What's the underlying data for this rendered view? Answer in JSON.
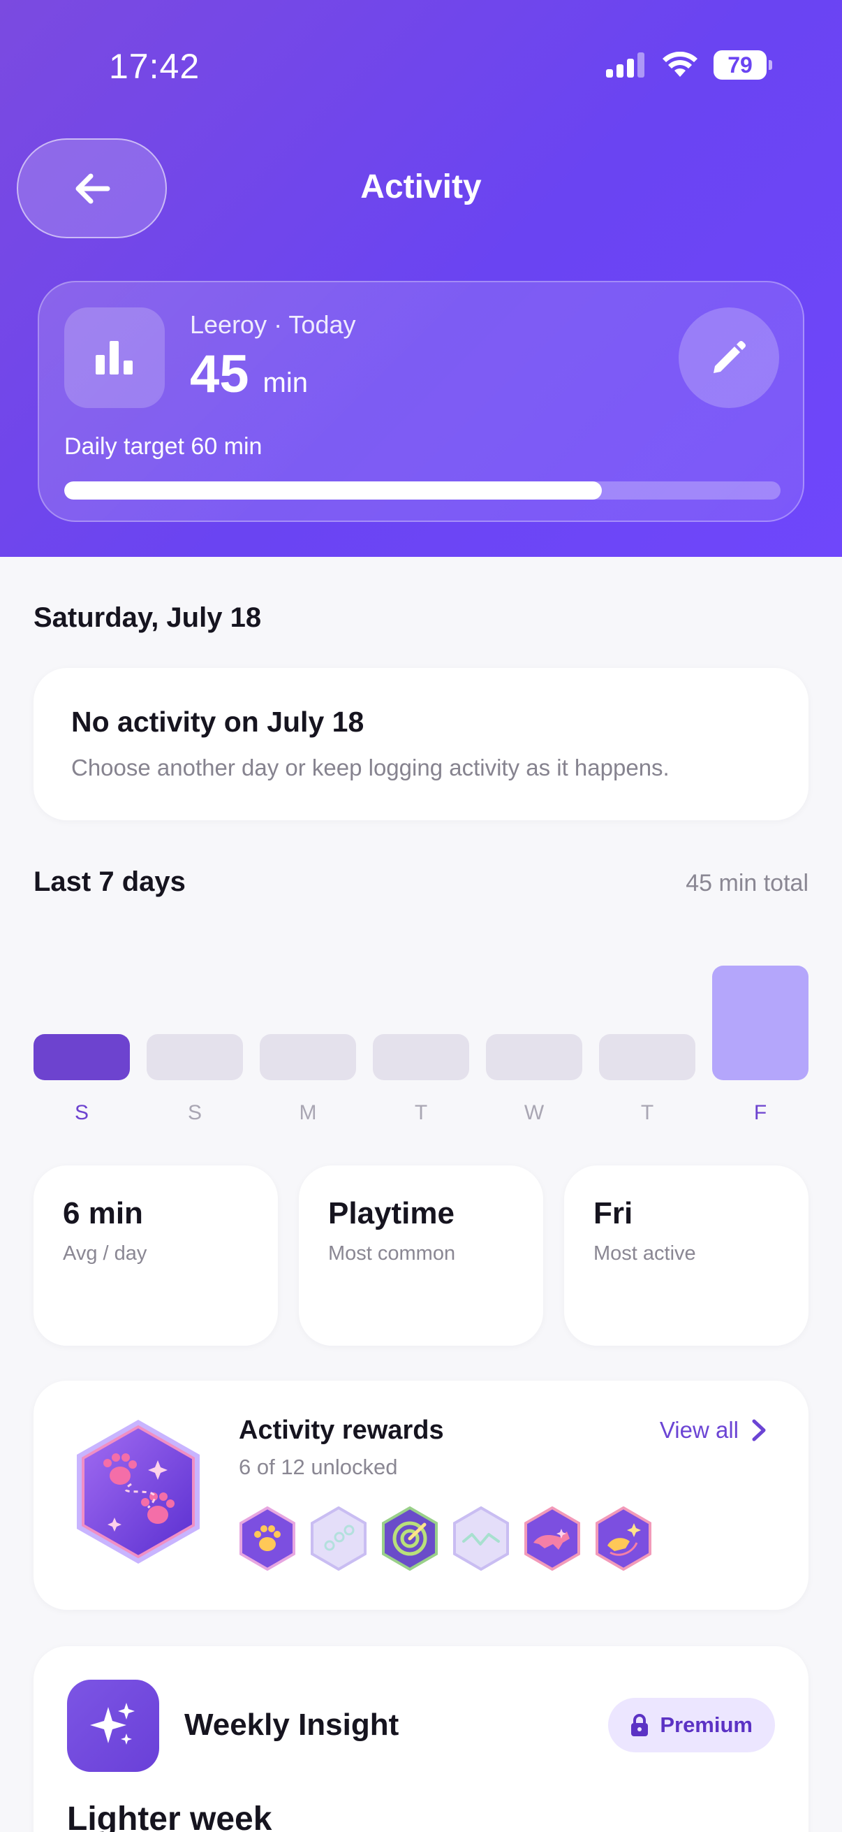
{
  "status_bar": {
    "time": "17:42",
    "battery": "79"
  },
  "header": {
    "title": "Activity"
  },
  "summary": {
    "subtitle": "Leeroy · Today",
    "value": "45",
    "unit": "min",
    "target_label": "Daily target 60 min",
    "progress_fraction": 0.75
  },
  "day": {
    "heading": "Saturday, July 18",
    "empty_title": "No activity on July 18",
    "empty_desc": "Choose another day or keep logging activity as it happens."
  },
  "week": {
    "title": "Last 7 days",
    "total": "45 min total",
    "days": [
      {
        "label": "S",
        "state": "selected",
        "minutes": 0
      },
      {
        "label": "S",
        "state": "empty",
        "minutes": 0
      },
      {
        "label": "M",
        "state": "empty",
        "minutes": 0
      },
      {
        "label": "T",
        "state": "empty",
        "minutes": 0
      },
      {
        "label": "W",
        "state": "empty",
        "minutes": 0
      },
      {
        "label": "T",
        "state": "empty",
        "minutes": 0
      },
      {
        "label": "F",
        "state": "active",
        "minutes": 45
      }
    ],
    "colors": {
      "selected": "#6d43cf",
      "empty": "#e4e1ec",
      "active": "#b4a6fb",
      "label_active": "#6d43cf",
      "label_muted": "#a9a6b3"
    }
  },
  "stats": [
    {
      "value": "6 min",
      "label": "Avg / day"
    },
    {
      "value": "Playtime",
      "label": "Most common"
    },
    {
      "value": "Fri",
      "label": "Most active"
    }
  ],
  "rewards": {
    "title": "Activity rewards",
    "subtitle": "6 of 12 unlocked",
    "view_all": "View all",
    "badges": [
      {
        "icon": "paw-badge-icon",
        "unlocked": true
      },
      {
        "icon": "dots-badge-icon",
        "unlocked": false
      },
      {
        "icon": "target-badge-icon",
        "unlocked": true
      },
      {
        "icon": "wave-badge-icon",
        "unlocked": false
      },
      {
        "icon": "running-dog-badge-icon",
        "unlocked": true
      },
      {
        "icon": "dog-sparkle-badge-icon",
        "unlocked": true
      }
    ]
  },
  "insight": {
    "title": "Weekly Insight",
    "premium": "Premium",
    "heading": "Lighter week"
  }
}
